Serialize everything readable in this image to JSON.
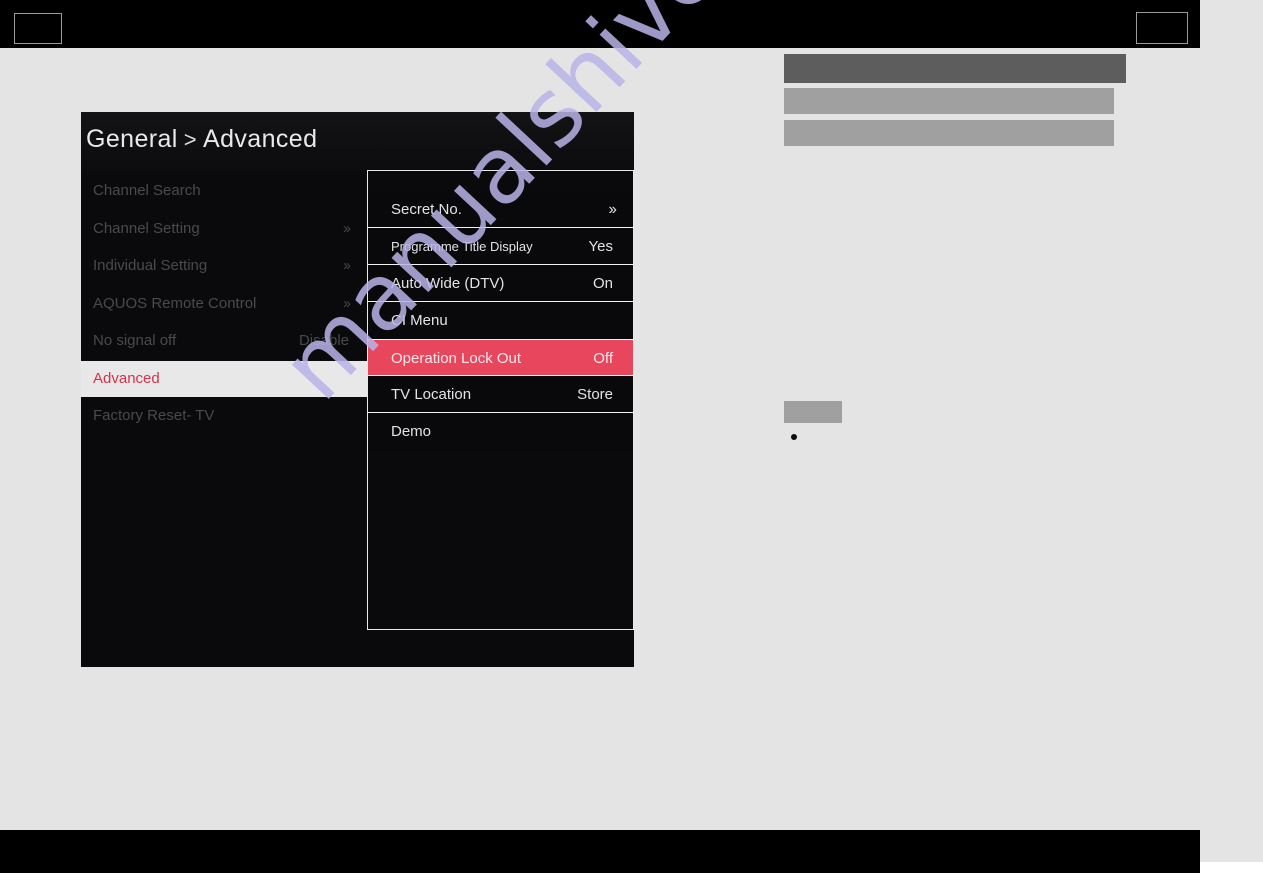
{
  "header": {
    "left_box_label": "",
    "right_box_label": ""
  },
  "placeholders": {
    "bar_1": "",
    "bar_2": "",
    "bar_3": "",
    "small_box": "",
    "bullet": ""
  },
  "osd": {
    "title_parts": {
      "parent": "General",
      "separator": ">",
      "current": "Advanced"
    },
    "left_menu": [
      {
        "label": "Channel Search",
        "value": "",
        "arrow": "",
        "selected": false
      },
      {
        "label": "Channel Setting",
        "value": "",
        "arrow": "››",
        "selected": false
      },
      {
        "label": "Individual Setting",
        "value": "",
        "arrow": "››",
        "selected": false
      },
      {
        "label": "AQUOS Remote Control",
        "value": "",
        "arrow": "››",
        "selected": false
      },
      {
        "label": "No signal off",
        "value": "Disable",
        "arrow": "",
        "selected": false
      },
      {
        "label": "Advanced",
        "value": "",
        "arrow": "",
        "selected": true
      },
      {
        "label": "Factory Reset- TV",
        "value": "",
        "arrow": "",
        "selected": false
      }
    ],
    "submenu": [
      {
        "label": "Secret No.",
        "value": "",
        "arrow": "››",
        "highlight": false,
        "small": false
      },
      {
        "label": "Programme Title Display",
        "value": "Yes",
        "arrow": "",
        "highlight": false,
        "small": true
      },
      {
        "label": "Auto Wide (DTV)",
        "value": "On",
        "arrow": "",
        "highlight": false,
        "small": false
      },
      {
        "label": "CI Menu",
        "value": "",
        "arrow": "",
        "highlight": false,
        "small": false
      },
      {
        "label": "Operation Lock Out",
        "value": "Off",
        "arrow": "",
        "highlight": true,
        "small": false
      },
      {
        "label": "TV Location",
        "value": "Store",
        "arrow": "",
        "highlight": false,
        "small": false
      },
      {
        "label": "Demo",
        "value": "",
        "arrow": "",
        "highlight": false,
        "small": false
      }
    ]
  },
  "watermark": {
    "text": "manualshive.com"
  },
  "colors": {
    "page_background": "#e4e4e4",
    "band_black": "#000000",
    "osd_background": "#0a0a0c",
    "highlight_red": "#e8465c",
    "selected_row_background": "#e8e8e8",
    "selected_row_text": "#d4334b",
    "dimmed_text": "#4a4a4d",
    "active_text": "#e3e3e6",
    "placeholder_gray": "#a0a0a0",
    "placeholder_dark_gray": "#5d5d5d",
    "watermark_purple": "#b9b4e8"
  }
}
